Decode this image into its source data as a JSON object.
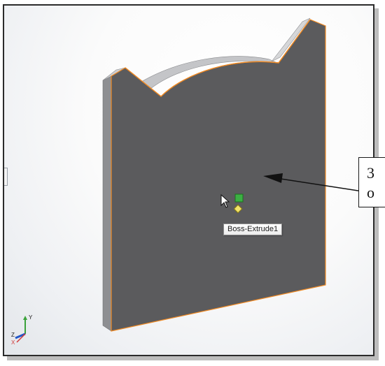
{
  "viewport": {
    "tooltip": "Boss-Extrude1",
    "callout": {
      "line1": "3",
      "line2": "o"
    },
    "triad": {
      "x": "X",
      "y": "Y",
      "z": "Z"
    },
    "colors": {
      "face": "#5b5b5d",
      "side": "#8e8f92",
      "top": "#d2d3d5",
      "edge_highlight": "#f08a24",
      "selection_handle": "#3cb043"
    }
  }
}
